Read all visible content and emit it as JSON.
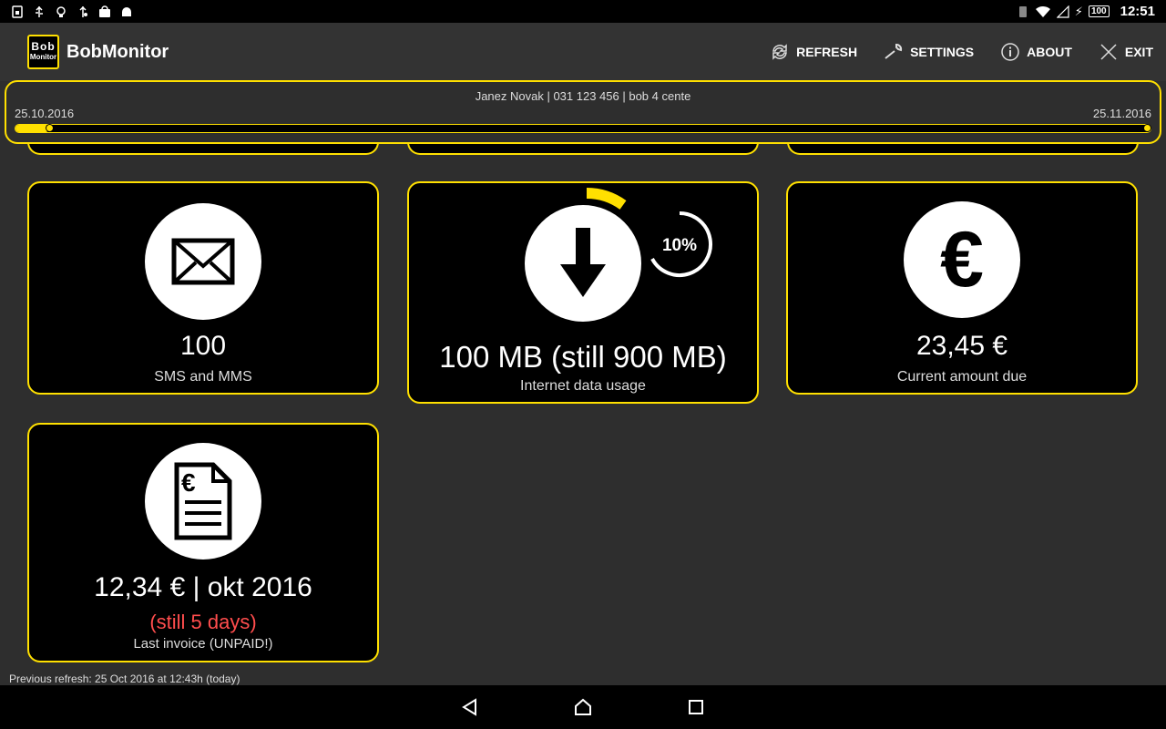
{
  "status_bar": {
    "left_icons": [
      "sim-icon",
      "usb-icon",
      "bulb-icon",
      "usb-debug-icon",
      "store-icon",
      "android-icon"
    ],
    "battery": "100",
    "time": "12:51"
  },
  "app_bar": {
    "logo_top": "Bob",
    "logo_bottom": "Monitor",
    "title": "BobMonitor",
    "actions": [
      {
        "label": "REFRESH",
        "icon": "refresh-icon"
      },
      {
        "label": "SETTINGS",
        "icon": "wrench-icon"
      },
      {
        "label": "ABOUT",
        "icon": "info-icon"
      },
      {
        "label": "EXIT",
        "icon": "close-icon"
      }
    ]
  },
  "period": {
    "caption": "Janez Novak | 031 123 456 | bob 4 cente",
    "start": "25.10.2016",
    "end": "25.11.2016",
    "progress_fraction": 0.03
  },
  "cards": {
    "sms": {
      "value": "100",
      "label": "SMS and MMS",
      "icon": "envelope-icon"
    },
    "data": {
      "value": "100 MB (still 900 MB)",
      "label": "Internet data usage",
      "percent": "10%",
      "usage_fraction": 0.1,
      "icon": "download-arrow-icon"
    },
    "amount": {
      "value": "23,45 €",
      "label": "Current amount due",
      "icon": "euro-icon"
    },
    "invoice": {
      "value": "12,34 € | okt 2016",
      "warning": "(still 5 days)",
      "label": "Last invoice (UNPAID!)",
      "icon": "invoice-icon"
    }
  },
  "footer": {
    "text": "Previous refresh: 25 Oct 2016 at 12:43h (today)"
  },
  "colors": {
    "accent": "#ffe000",
    "warning": "#ff4d4d",
    "background": "#2e2e2e",
    "card": "#000000"
  }
}
